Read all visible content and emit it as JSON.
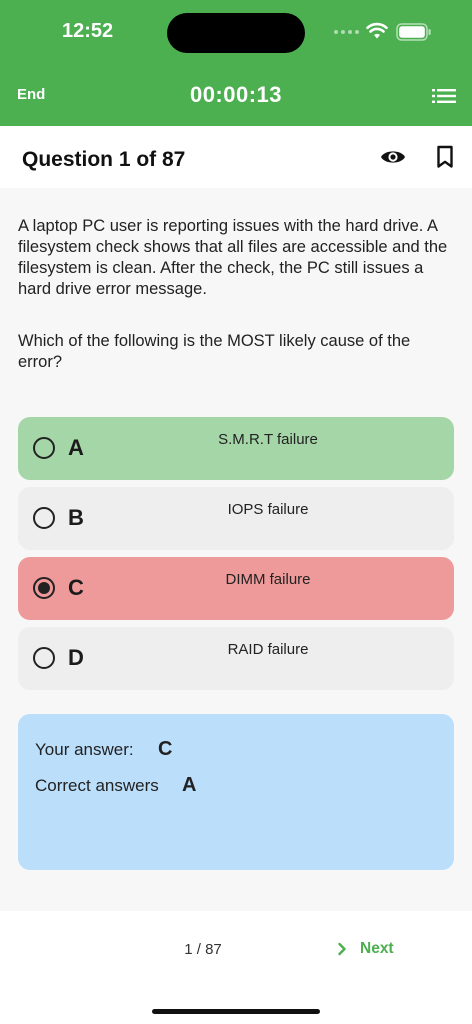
{
  "status_bar": {
    "time": "12:52"
  },
  "app_bar": {
    "end_label": "End",
    "timer": "00:00:13",
    "menu_icon": "list-menu-icon"
  },
  "question": {
    "title": "Question 1 of 87",
    "text": "A laptop PC user is reporting issues with the hard drive. A filesystem check shows that all files are accessible and the filesystem is clean. After the check, the PC still issues a hard drive error message.",
    "prompt": "Which of the following is the MOST likely cause of the error?"
  },
  "options": [
    {
      "letter": "A",
      "text": "S.M.R.T failure",
      "state": "correct",
      "selected": false
    },
    {
      "letter": "B",
      "text": "IOPS failure",
      "state": "neutral",
      "selected": false
    },
    {
      "letter": "C",
      "text": "DIMM failure",
      "state": "wrong",
      "selected": true
    },
    {
      "letter": "D",
      "text": "RAID failure",
      "state": "neutral",
      "selected": false
    }
  ],
  "result": {
    "your_answer_label": "Your answer:",
    "your_answer": "C",
    "correct_answers_label": "Correct answers",
    "correct_answers": "A"
  },
  "footer": {
    "page": "1 / 87",
    "next_label": "Next"
  },
  "colors": {
    "primary": "#4caf50",
    "correct": "#a5d6a7",
    "wrong": "#ef9a9a",
    "neutral": "#eeeeee",
    "result_panel": "#bbdefb"
  }
}
